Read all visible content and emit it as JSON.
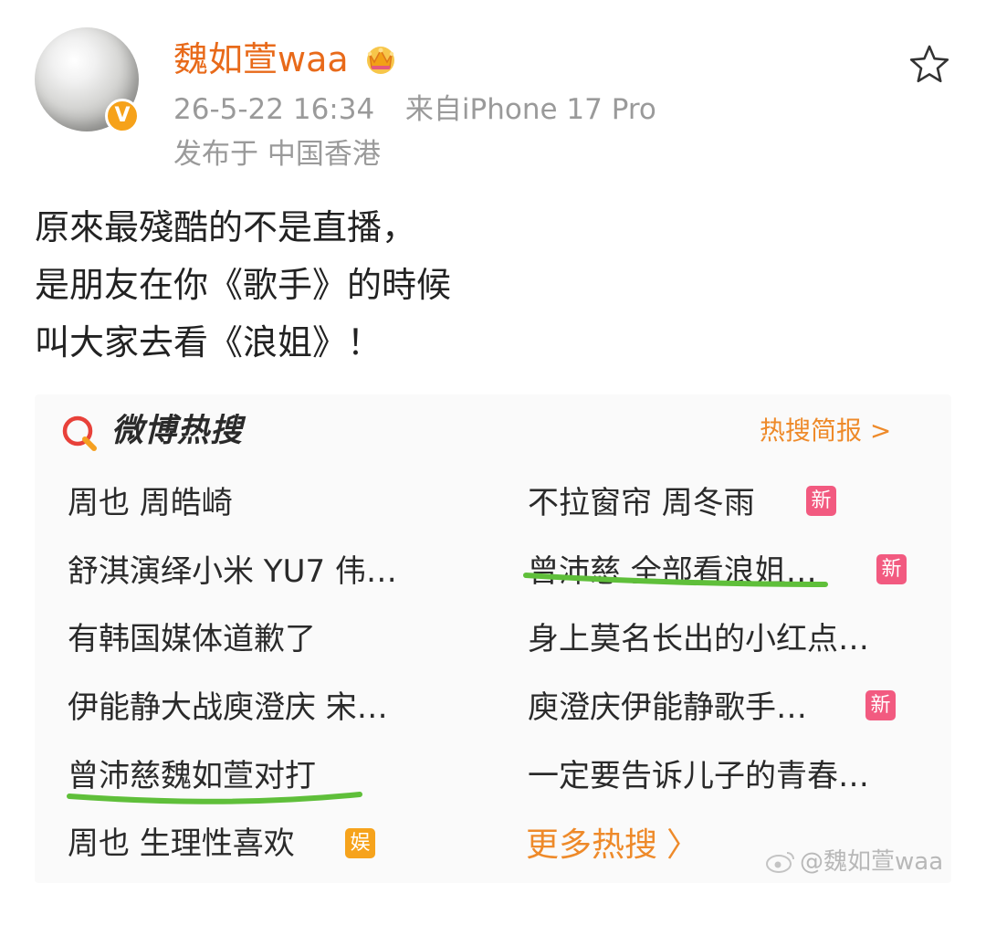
{
  "post": {
    "username": "魏如萱waa",
    "datetime": "26-5-22 16:34",
    "source": "来自iPhone 17 Pro",
    "location": "发布于 中国香港",
    "text_lines": [
      "原來最殘酷的不是直播，",
      "是朋友在你《歌手》的時候",
      "叫大家去看《浪姐》！"
    ],
    "verified_mark": "V"
  },
  "hot_search": {
    "title": "微博热搜",
    "report_link": "热搜简报 >",
    "left_items": [
      {
        "text": "周也 周皓崎"
      },
      {
        "text": "舒淇演绎小米 YU7 伟…"
      },
      {
        "text": "有韩国媒体道歉了"
      },
      {
        "text": "伊能静大战庾澄庆 宋…"
      },
      {
        "text": "曾沛慈魏如萱对打",
        "highlighted": true
      },
      {
        "text": "周也 生理性喜欢",
        "badge": "娱"
      }
    ],
    "right_items": [
      {
        "text": "不拉窗帘 周冬雨",
        "badge": "新"
      },
      {
        "text": "曾沛慈 全部看浪姐…",
        "badge": "新",
        "highlighted": true
      },
      {
        "text": "身上莫名长出的小红点…"
      },
      {
        "text": "庾澄庆伊能静歌手…",
        "badge": "新"
      },
      {
        "text": "一定要告诉儿子的青春…"
      }
    ],
    "more": "更多热搜",
    "more_arrow": "〉"
  },
  "watermark": "@魏如萱waa",
  "colors": {
    "username": "#e86a1a",
    "accent": "#ee8a2a",
    "badge_new": "#f25a80",
    "badge_ent": "#f6a31c",
    "highlight_underline": "#5fbf3a",
    "meta_gray": "#9a9a9a"
  },
  "icons": {
    "favorite": "star-outline-icon",
    "crown": "crown-icon",
    "verified": "verified-badge-icon",
    "hot_search_logo": "weibo-search-logo-icon",
    "watermark": "weibo-eye-icon"
  }
}
